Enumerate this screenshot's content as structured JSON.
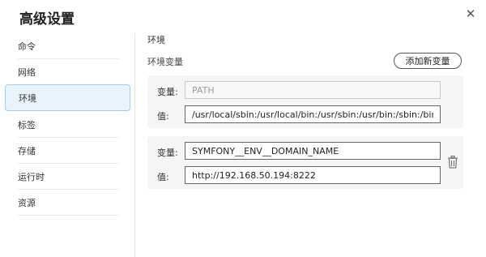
{
  "dialog": {
    "title": "高级设置"
  },
  "sidebar": {
    "items": [
      {
        "label": "命令"
      },
      {
        "label": "网络"
      },
      {
        "label": "环境"
      },
      {
        "label": "标签"
      },
      {
        "label": "存储"
      },
      {
        "label": "运行时"
      },
      {
        "label": "资源"
      }
    ],
    "active": "环境"
  },
  "main": {
    "section_title": "环境",
    "subsection_title": "环境变量",
    "add_button_label": "添加新变量",
    "variables": [
      {
        "var_label": "变量:",
        "var_value": "PATH",
        "val_label": "值:",
        "val_value": "/usr/local/sbin:/usr/local/bin:/usr/sbin:/usr/bin:/sbin:/bin:/var/",
        "editable": false
      },
      {
        "var_label": "变量:",
        "var_value": "SYMFONY__ENV__DOMAIN_NAME",
        "val_label": "值:",
        "val_value": "http://192.168.50.194:8222",
        "editable": true
      }
    ]
  },
  "colors": {
    "active_bg": "#e9f3fb",
    "active_border": "#a9cbe8",
    "card_bg": "#f5f5f7"
  },
  "icons": {
    "close": "close-icon",
    "delete": "trash-icon"
  }
}
